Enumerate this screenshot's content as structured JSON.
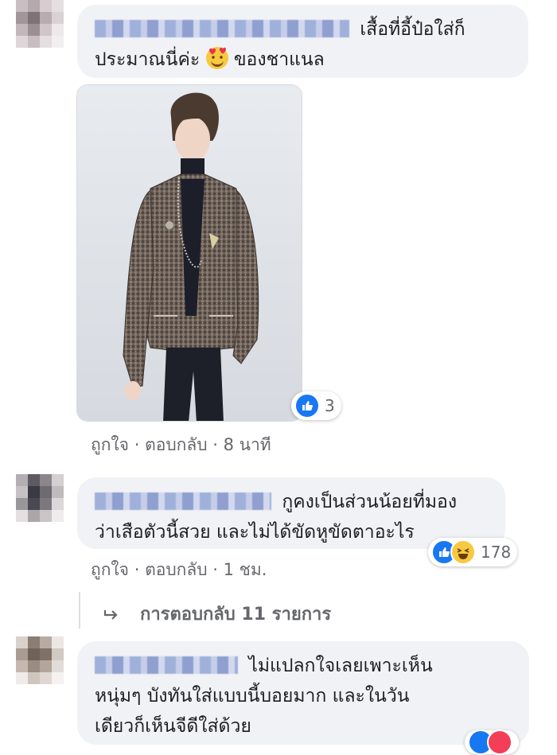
{
  "comments": [
    {
      "text_line1": "เสื้อที่อี้ป๋อใส่ก็",
      "text_line2_a": "ประมาณนี่ค่ะ",
      "text_line2_b": "ของชาแนล",
      "emoji": "smiling-face-with-hearts-icon",
      "reaction_count": "3",
      "like_label": "ถูกใจ",
      "reply_label": "ตอบกลับ",
      "time": "8 นาที"
    },
    {
      "text_line1": "กูคงเป็นส่วนน้อยที่มอง",
      "text_line2": "ว่าเสือตัวนี้สวย และไม่ได้ขัดหูขัดตาอะไร",
      "reaction_count": "178",
      "like_label": "ถูกใจ",
      "reply_label": "ตอบกลับ",
      "time": "1 ชม."
    },
    {
      "text_line1": "ไม่แปลกใจเลยเพาะเห็น",
      "text_line2": "หนุ่มๆ บังทันใส่แบบนี้บอยมาก และในวัน",
      "text_line3": "เดียวก็เห็นจีดีใส่ด้วย"
    }
  ],
  "replies": {
    "label": "การตอบกลับ 11 รายการ"
  },
  "separator": "·",
  "colors": {
    "bubble_bg": "#f0f2f5",
    "meta_text": "#65676b",
    "like_blue": "#1877f2",
    "haha_yellow": "#f7c940",
    "love_red": "#f33e58"
  }
}
